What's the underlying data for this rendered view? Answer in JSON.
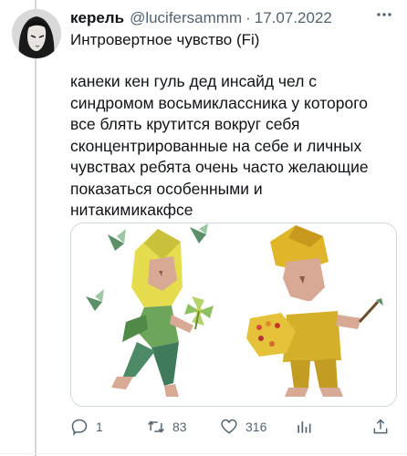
{
  "tweet": {
    "display_name": "керель",
    "handle": "@lucifersammm",
    "separator": "·",
    "date": "17.07.2022",
    "first_line": "Интровертное чувство (Fi)",
    "body": "канеки кен гуль дед инсайд чел с\nсиндромом восьмиклассника у которого\nвсе блять крутится вокруг себя\nсконцентрированные на себе и личных\nчувствах ребята очень часто желающие\nпоказаться особенными и\nнитакимикакфсе"
  },
  "actions": {
    "reply_count": "1",
    "retweet_count": "83",
    "like_count": "316"
  },
  "icons": [
    "more-icon",
    "reply-icon",
    "retweet-icon",
    "like-icon",
    "analytics-icon",
    "share-icon"
  ],
  "colors": {
    "text": "#0f1419",
    "secondary": "#536471",
    "border": "#cfd9de"
  }
}
